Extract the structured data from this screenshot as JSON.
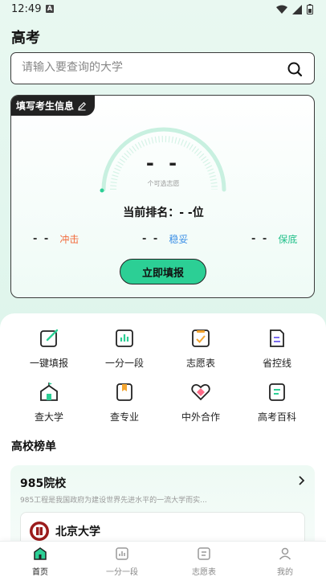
{
  "status_bar": {
    "time": "12:49",
    "notif_letter": "A",
    "icons": [
      "wifi-icon",
      "signal-icon",
      "battery-icon"
    ]
  },
  "page": {
    "title": "高考"
  },
  "search": {
    "placeholder": "请输入要查询的大学",
    "icon": "search-icon"
  },
  "info_card": {
    "tag_label": "填写考生信息",
    "tag_icon": "pencil-icon",
    "gauge_value": "- -",
    "gauge_caption": "个可选志愿",
    "rank_label": "当前排名：",
    "rank_value": "- -位",
    "risk": [
      {
        "value": "- -",
        "label": "冲击",
        "color": "#f26a3b"
      },
      {
        "value": "- -",
        "label": "稳妥",
        "color": "#3c8fe6"
      },
      {
        "value": "- -",
        "label": "保底",
        "color": "#22c08a"
      }
    ],
    "submit_label": "立即填报"
  },
  "shortcuts": [
    {
      "label": "一键填报",
      "icon": "edit-icon"
    },
    {
      "label": "一分一段",
      "icon": "bar-chart-icon"
    },
    {
      "label": "志愿表",
      "icon": "checklist-icon"
    },
    {
      "label": "省控线",
      "icon": "document-icon"
    },
    {
      "label": "查大学",
      "icon": "school-icon"
    },
    {
      "label": "查专业",
      "icon": "book-icon"
    },
    {
      "label": "中外合作",
      "icon": "handshake-icon"
    },
    {
      "label": "高考百科",
      "icon": "encyclopedia-icon"
    }
  ],
  "rankings": {
    "section_title": "高校榜单",
    "card_title": "985院校",
    "card_desc": "985工程是我国政府为建设世界先进水平的一流大学而实...",
    "university_name": "北京大学"
  },
  "tabs": [
    {
      "label": "首页",
      "icon": "home-icon",
      "active": true
    },
    {
      "label": "一分一段",
      "icon": "bar-chart-icon",
      "active": false
    },
    {
      "label": "志愿表",
      "icon": "list-icon",
      "active": false
    },
    {
      "label": "我的",
      "icon": "user-icon",
      "active": false
    }
  ],
  "colors": {
    "accent": "#2ccf95",
    "accent_light": "#c8f0e0",
    "dark": "#222222"
  }
}
